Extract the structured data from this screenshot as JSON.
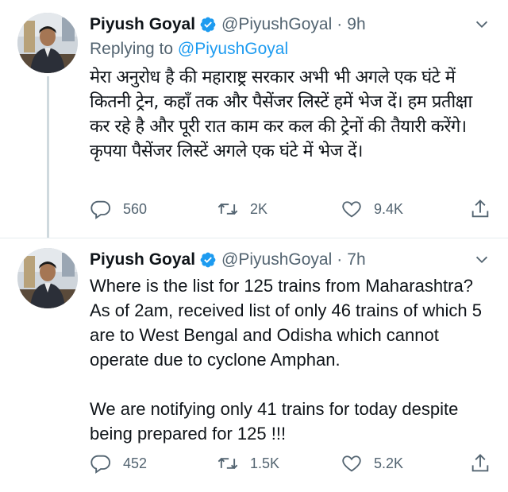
{
  "tweets": [
    {
      "author_name": "Piyush Goyal",
      "handle": "@PiyushGoyal",
      "separator": "·",
      "time": "9h",
      "replying_label": "Replying to",
      "replying_to": "@PiyushGoyal",
      "paragraphs": [
        "मेरा अनुरोध है की महाराष्ट्र सरकार अभी भी अगले एक घंटे में कितनी ट्रेन, कहाँ तक और पैसेंजर लिस्टें हमें भेज दें। हम प्रतीक्षा कर रहे है और पूरी रात काम कर कल की ट्रेनों की तैयारी करेंगे। कृपया पैसेंजर लिस्टें अगले एक घंटे में भेज दें।"
      ],
      "counts": {
        "replies": "560",
        "retweets": "2K",
        "likes": "9.4K"
      }
    },
    {
      "author_name": "Piyush Goyal",
      "handle": "@PiyushGoyal",
      "separator": "·",
      "time": "7h",
      "paragraphs": [
        "Where is the list for 125 trains from Maharashtra? As of 2am, received list of only 46 trains of which 5 are to West Bengal and Odisha which cannot operate due to cyclone Amphan.",
        "We are notifying only 41 trains for today despite being prepared for 125 !!!"
      ],
      "counts": {
        "replies": "452",
        "retweets": "1.5K",
        "likes": "5.2K"
      }
    }
  ],
  "icons": {
    "verified": "verified-badge-icon",
    "more": "chevron-down-icon",
    "reply": "reply-bubble-icon",
    "retweet": "retweet-icon",
    "like": "heart-icon",
    "share": "share-icon"
  },
  "colors": {
    "link": "#1d9bf0",
    "secondary_text": "#536471",
    "primary_text": "#0f1419",
    "verified": "#1d9bf0",
    "divider": "#e6ecf0"
  }
}
